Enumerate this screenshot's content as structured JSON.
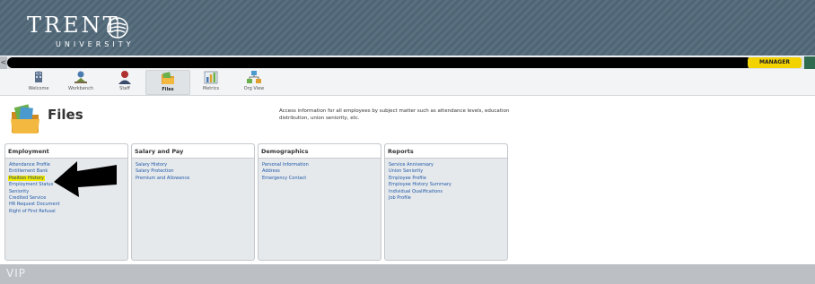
{
  "header": {
    "logo_main": "TRENT",
    "logo_sub": "UNIVERSITY"
  },
  "navbar": {
    "left_arrow": "<",
    "portal_button": "MANAGER PORTAL"
  },
  "toolbar": {
    "items": [
      {
        "label": "Welcome",
        "icon": "welcome-icon"
      },
      {
        "label": "Workbench",
        "icon": "workbench-icon"
      },
      {
        "label": "Staff",
        "icon": "staff-icon"
      },
      {
        "label": "Files",
        "icon": "files-icon"
      },
      {
        "label": "Metrics",
        "icon": "metrics-icon"
      },
      {
        "label": "Org View",
        "icon": "org-view-icon"
      }
    ],
    "active": "Files"
  },
  "page": {
    "title": "Files",
    "intro": "Access information for all employees by subject matter such as attendance levels, education distribution, union seniority, etc."
  },
  "cards": [
    {
      "title": "Employment",
      "items": [
        "Attendance Profile",
        "Entitlement Bank",
        "Position History",
        "Employment Status",
        "Seniority",
        "Credited Service",
        "HR Request Document",
        "Right of First Refusal"
      ]
    },
    {
      "title": "Salary and Pay",
      "items": [
        "Salary History",
        "Salary Protection",
        "Premium and Allowance"
      ]
    },
    {
      "title": "Demographics",
      "items": [
        "Personal Information",
        "Address",
        "Emergency Contact"
      ]
    },
    {
      "title": "Reports",
      "items": [
        "Service Anniversary",
        "Union Seniority",
        "Employee Profile",
        "Employee History Summary",
        "Individual Qualifications",
        "Job Profile"
      ]
    }
  ],
  "highlighted_item": "Position History",
  "footer": {
    "logo": "VIP"
  },
  "colors": {
    "banner": "#56697a",
    "portal": "#f2d300",
    "highlight": "#f2ea00",
    "link": "#1f59a8"
  }
}
